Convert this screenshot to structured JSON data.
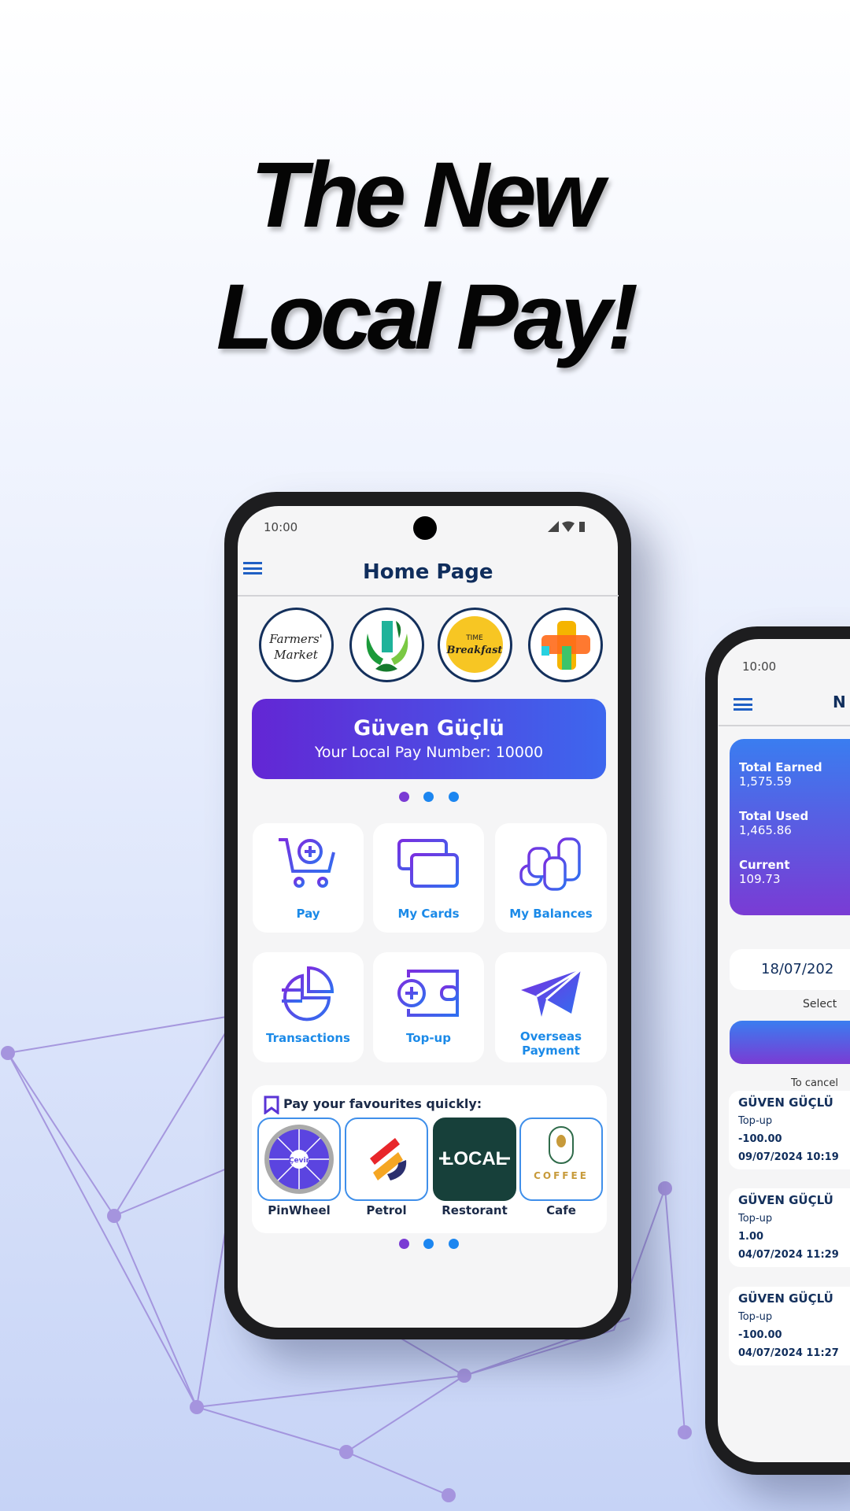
{
  "headline": {
    "line1": "The New",
    "line2": "Local Pay!"
  },
  "colors": {
    "accent_purple": "#6326d4",
    "accent_blue": "#3d67ee",
    "label_blue": "#1b8ae8",
    "title_navy": "#0f2d5c"
  },
  "phone_home": {
    "status": {
      "time": "10:00",
      "icons": [
        "signal-icon",
        "wifi-icon",
        "battery-icon"
      ]
    },
    "header": {
      "title": "Home Page",
      "menu_icon": "hamburger-icon"
    },
    "merchant_logos": [
      "Farmers' Market",
      "tree-logo",
      "Time Breakfast",
      "plus-logo"
    ],
    "banner": {
      "name": "Güven Güçlü",
      "number_text": "Your Local Pay Number: 10000"
    },
    "tiles": [
      {
        "label": "Pay",
        "icon": "cart-plus-icon"
      },
      {
        "label": "My Cards",
        "icon": "cards-icon"
      },
      {
        "label": "My Balances",
        "icon": "coins-icon"
      },
      {
        "label": "Transactions",
        "icon": "pie-chart-icon"
      },
      {
        "label": "Top-up",
        "icon": "wallet-plus-icon"
      },
      {
        "label": "Overseas Payment",
        "icon": "paper-plane-icon"
      }
    ],
    "favourites": {
      "title": "Pay your favourites quickly:",
      "items": [
        {
          "label": "PinWheel",
          "logo_text": "Çevir"
        },
        {
          "label": "Petrol"
        },
        {
          "label": "Restorant",
          "logo_text": "LOCAL"
        },
        {
          "label": "Cafe",
          "logo_text": "COFFEE"
        }
      ]
    }
  },
  "phone_balance": {
    "status": {
      "time": "10:00"
    },
    "header": {
      "title_partial": "N"
    },
    "balances": [
      {
        "label": "Total Earned",
        "value": "1,575.59"
      },
      {
        "label": "Total Used",
        "value": "1,465.86"
      },
      {
        "label": "Current",
        "value": "109.73"
      }
    ],
    "date": "18/07/202",
    "select_label": "Select",
    "cancel_label": "To cancel",
    "transactions": [
      {
        "name": "GÜVEN GÜÇLÜ",
        "type": "Top-up",
        "amount": "-100.00",
        "date": "09/07/2024 10:19"
      },
      {
        "name": "GÜVEN GÜÇLÜ",
        "type": "Top-up",
        "amount": "1.00",
        "date": "04/07/2024 11:29"
      },
      {
        "name": "GÜVEN GÜÇLÜ",
        "type": "Top-up",
        "amount": "-100.00",
        "date": "04/07/2024 11:27"
      }
    ]
  }
}
